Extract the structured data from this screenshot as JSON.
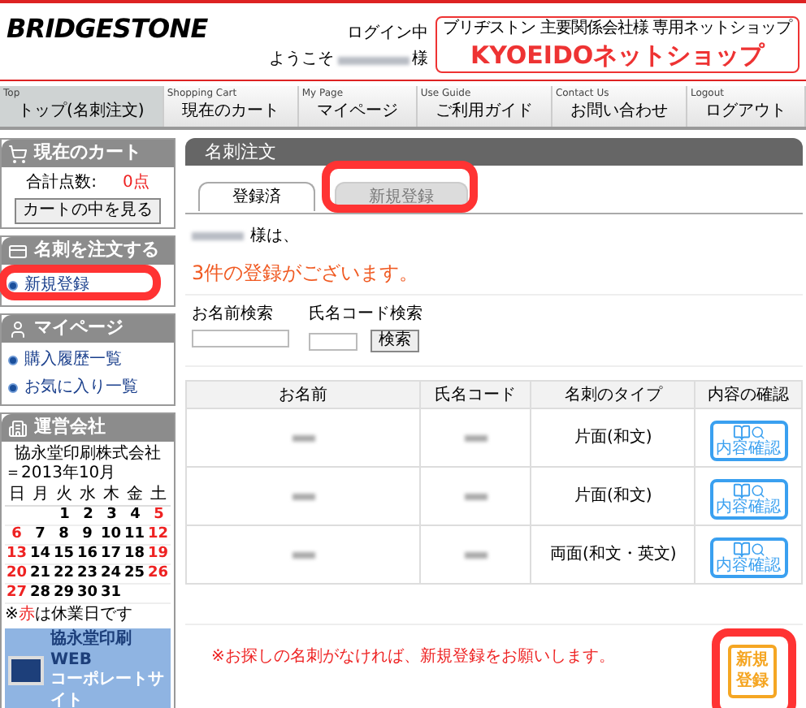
{
  "header": {
    "logo": "BRIDGESTONE",
    "login_status": "ログイン中",
    "welcome": "ようこそ",
    "honorific": "様",
    "shop_banner": {
      "subtitle": "ブリヂストン 主要関係会社様 専用ネットショップ",
      "title": "KYOEIDOネットショップ"
    }
  },
  "nav": [
    {
      "en": "Top",
      "ja": "トップ(名刺注文)",
      "selected": true
    },
    {
      "en": "Shopping Cart",
      "ja": "現在のカート",
      "selected": false
    },
    {
      "en": "My Page",
      "ja": "マイページ",
      "selected": false
    },
    {
      "en": "Use Guide",
      "ja": "ご利用ガイド",
      "selected": false
    },
    {
      "en": "Contact Us",
      "ja": "お問い合わせ",
      "selected": false
    },
    {
      "en": "Logout",
      "ja": "ログアウト",
      "selected": false
    }
  ],
  "sidebar": {
    "cart": {
      "title": "現在のカート",
      "total_label": "合計点数:",
      "total_value": "0点",
      "button": "カートの中を見る"
    },
    "order": {
      "title": "名刺を注文する",
      "links": [
        {
          "label": "新規登録",
          "highlighted": true
        }
      ]
    },
    "mypage": {
      "title": "マイページ",
      "links": [
        {
          "label": "購入履歴一覧",
          "highlighted": false
        },
        {
          "label": "お気に入り一覧",
          "highlighted": false
        }
      ]
    },
    "company": {
      "title": "運営会社",
      "name": "協永堂印刷株式会社",
      "month": "＝2013年10月",
      "weekdays": [
        {
          "label": "日",
          "holiday": false
        },
        {
          "label": "月",
          "holiday": false
        },
        {
          "label": "火",
          "holiday": false
        },
        {
          "label": "水",
          "holiday": false
        },
        {
          "label": "木",
          "holiday": false
        },
        {
          "label": "金",
          "holiday": false
        },
        {
          "label": "土",
          "holiday": false
        }
      ],
      "weeks": [
        [
          {
            "day": "1",
            "holiday": false
          },
          {
            "day": "2",
            "holiday": false
          },
          {
            "day": "3",
            "holiday": false
          },
          {
            "day": "4",
            "holiday": false
          },
          {
            "day": "5",
            "holiday": true
          }
        ],
        [
          {
            "day": "6",
            "holiday": true
          },
          {
            "day": "7",
            "holiday": false
          },
          {
            "day": "8",
            "holiday": false
          },
          {
            "day": "9",
            "holiday": false
          },
          {
            "day": "10",
            "holiday": false
          },
          {
            "day": "11",
            "holiday": false
          },
          {
            "day": "12",
            "holiday": true
          }
        ],
        [
          {
            "day": "13",
            "holiday": true
          },
          {
            "day": "14",
            "holiday": false
          },
          {
            "day": "15",
            "holiday": false
          },
          {
            "day": "16",
            "holiday": false
          },
          {
            "day": "17",
            "holiday": false
          },
          {
            "day": "18",
            "holiday": false
          },
          {
            "day": "19",
            "holiday": true
          }
        ],
        [
          {
            "day": "20",
            "holiday": true
          },
          {
            "day": "21",
            "holiday": false
          },
          {
            "day": "22",
            "holiday": false
          },
          {
            "day": "23",
            "holiday": false
          },
          {
            "day": "24",
            "holiday": false
          },
          {
            "day": "25",
            "holiday": false
          },
          {
            "day": "26",
            "holiday": true
          }
        ],
        [
          {
            "day": "27",
            "holiday": true
          },
          {
            "day": "28",
            "holiday": false
          },
          {
            "day": "29",
            "holiday": false
          },
          {
            "day": "30",
            "holiday": false
          },
          {
            "day": "31",
            "holiday": false
          }
        ]
      ],
      "note_prefix": "※",
      "note_red": "赤",
      "note_suffix": "は休業日です",
      "banner_line1": "協永堂印刷 WEB",
      "banner_line2": "コーポレートサイト"
    }
  },
  "main": {
    "title": "名刺注文",
    "tabs": [
      {
        "label": "登録済",
        "selected": true,
        "highlighted": false
      },
      {
        "label": "新規登録",
        "selected": false,
        "highlighted": true
      }
    ],
    "greeting": "様は、",
    "count_message": "3件の登録がございます。",
    "search": {
      "name_label": "お名前検索",
      "code_label": "氏名コード検索",
      "button": "検索"
    },
    "table": {
      "columns": [
        "お名前",
        "氏名コード",
        "名刺のタイプ",
        "内容の確認"
      ],
      "rows": [
        {
          "type": "片面(和文)",
          "action": "内容確認"
        },
        {
          "type": "片面(和文)",
          "action": "内容確認"
        },
        {
          "type": "両面(和文・英文)",
          "action": "内容確認"
        }
      ]
    },
    "footer_note": "※お探しの名刺がなければ、新規登録をお願いします。",
    "new_button": {
      "line1": "新規",
      "line2": "登録",
      "highlighted": true
    }
  }
}
